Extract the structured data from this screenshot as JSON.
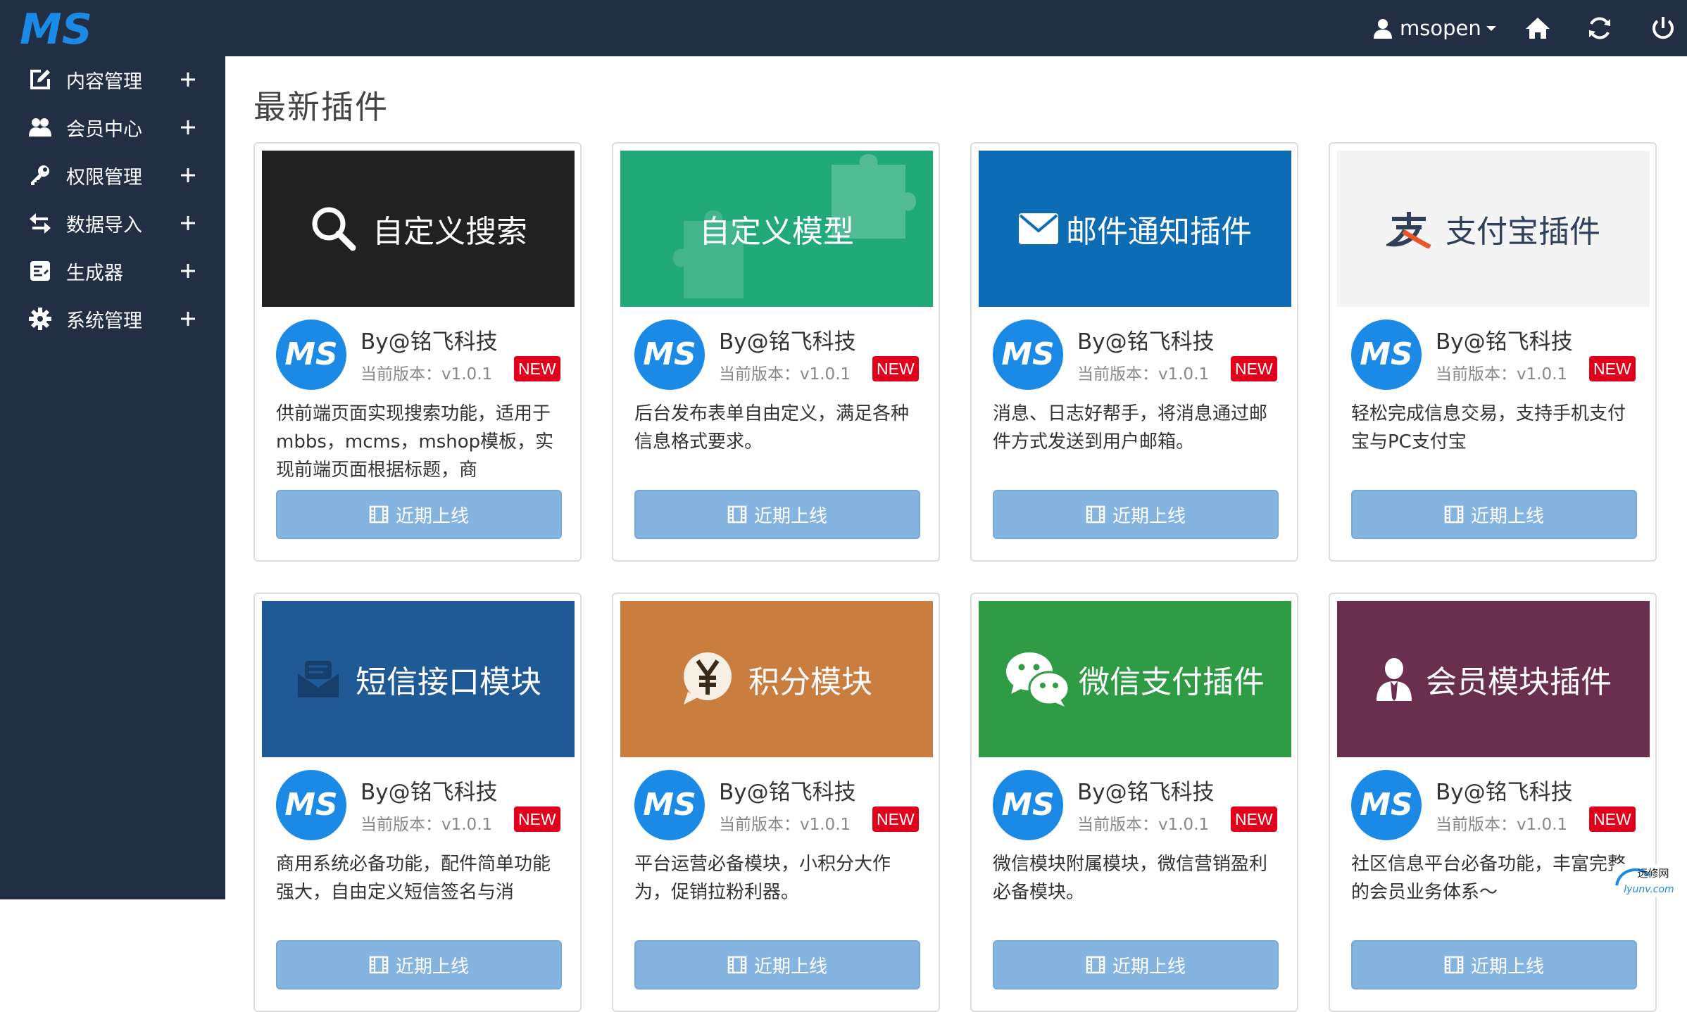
{
  "app": {
    "logo_text": "MS"
  },
  "header": {
    "username": "msopen"
  },
  "sidebar": {
    "items": [
      {
        "label": "内容管理",
        "icon": "edit-icon"
      },
      {
        "label": "会员中心",
        "icon": "users-icon"
      },
      {
        "label": "权限管理",
        "icon": "key-icon"
      },
      {
        "label": "数据导入",
        "icon": "transfer-icon"
      },
      {
        "label": "生成器",
        "icon": "form-icon"
      },
      {
        "label": "系统管理",
        "icon": "gear-icon"
      }
    ]
  },
  "main": {
    "title": "最新插件",
    "cards": [
      {
        "banner": "自定义搜索",
        "banner_color": "#212121",
        "banner_text_color": "#ffffff",
        "icon": "search-icon",
        "author": "By@铭飞科技",
        "version": "当前版本：v1.0.1",
        "badge": "NEW",
        "desc": "供前端页面实现搜索功能，适用于mbbs，mcms，mshop模板，实现前端页面根据标题，商",
        "button": "近期上线"
      },
      {
        "banner": "自定义模型",
        "banner_color": "#22a97a",
        "banner_text_color": "#ffffff",
        "icon": "puzzle-icon",
        "author": "By@铭飞科技",
        "version": "当前版本：v1.0.1",
        "badge": "NEW",
        "desc": "后台发布表单自由定义，满足各种信息格式要求。",
        "button": "近期上线"
      },
      {
        "banner": "邮件通知插件",
        "banner_color": "#0c6db4",
        "banner_text_color": "#ffffff",
        "icon": "mail-icon",
        "author": "By@铭飞科技",
        "version": "当前版本：v1.0.1",
        "badge": "NEW",
        "desc": "消息、日志好帮手，将消息通过邮件方式发送到用户邮箱。",
        "button": "近期上线"
      },
      {
        "banner": "支付宝插件",
        "banner_color": "#f4f4f4",
        "banner_text_color": "#2f3f5a",
        "icon": "alipay-icon",
        "author": "By@铭飞科技",
        "version": "当前版本：v1.0.1",
        "badge": "NEW",
        "desc": "轻松完成信息交易，支持手机支付宝与PC支付宝",
        "button": "近期上线"
      },
      {
        "banner": "短信接口模块",
        "banner_color": "#1f5a97",
        "banner_text_color": "#ffffff",
        "icon": "sms-icon",
        "author": "By@铭飞科技",
        "version": "当前版本：v1.0.1",
        "badge": "NEW",
        "desc": "商用系统必备功能，配件简单功能强大，自由定义短信签名与消",
        "button": "近期上线"
      },
      {
        "banner": "积分模块",
        "banner_color": "#c97d3e",
        "banner_text_color": "#ffffff",
        "icon": "yen-icon",
        "author": "By@铭飞科技",
        "version": "当前版本：v1.0.1",
        "badge": "NEW",
        "desc": "平台运营必备模块，小积分大作为，促销拉粉利器。",
        "button": "近期上线"
      },
      {
        "banner": "微信支付插件",
        "banner_color": "#2f9b45",
        "banner_text_color": "#ffffff",
        "icon": "wechat-icon",
        "author": "By@铭飞科技",
        "version": "当前版本：v1.0.1",
        "badge": "NEW",
        "desc": "微信模块附属模块，微信营销盈利必备模块。",
        "button": "近期上线"
      },
      {
        "banner": "会员模块插件",
        "banner_color": "#6a2e4f",
        "banner_text_color": "#ffffff",
        "icon": "member-icon",
        "author": "By@铭飞科技",
        "version": "当前版本：v1.0.1",
        "badge": "NEW",
        "desc": "社区信息平台必备功能，丰富完整的会员业务体系～",
        "button": "近期上线"
      }
    ]
  },
  "watermark": {
    "title": "远修网",
    "url": "lyunv.com"
  },
  "colors": {
    "nav_bg": "#222e43",
    "accent": "#1a8ae6",
    "badge": "#e0001b",
    "button": "#85b4e0"
  }
}
